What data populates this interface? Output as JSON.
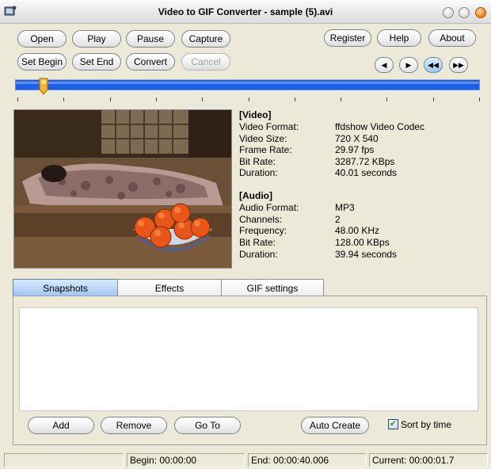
{
  "window": {
    "title": "Video to GIF Converter - sample (5).avi"
  },
  "toolbar": {
    "open": "Open",
    "play": "Play",
    "pause": "Pause",
    "capture": "Capture",
    "set_begin": "Set Begin",
    "set_end": "Set End",
    "convert": "Convert",
    "cancel": "Cancel",
    "register": "Register",
    "help": "Help",
    "about": "About"
  },
  "nav_buttons": {
    "prev": "◀",
    "next": "▶",
    "rewind": "◀◀",
    "forward": "▶▶"
  },
  "position": {
    "fraction": 0.052
  },
  "video_info": {
    "header": "[Video]",
    "rows": [
      {
        "label": "Video Format:",
        "value": "ffdshow Video Codec"
      },
      {
        "label": "Video Size:",
        "value": "720 X 540"
      },
      {
        "label": "Frame Rate:",
        "value": "29.97 fps"
      },
      {
        "label": "Bit Rate:",
        "value": "3287.72 KBps"
      },
      {
        "label": "Duration:",
        "value": "40.01 seconds"
      }
    ]
  },
  "audio_info": {
    "header": "[Audio]",
    "rows": [
      {
        "label": "Audio Format:",
        "value": "MP3"
      },
      {
        "label": "Channels:",
        "value": "2"
      },
      {
        "label": "Frequency:",
        "value": "48.00 KHz"
      },
      {
        "label": "Bit Rate:",
        "value": "128.00 KBps"
      },
      {
        "label": "Duration:",
        "value": "39.94 seconds"
      }
    ]
  },
  "tabs": [
    "Snapshots",
    "Effects",
    "GIF settings"
  ],
  "snapshots": {
    "add": "Add",
    "remove": "Remove",
    "goto": "Go To",
    "auto_create": "Auto Create",
    "sort_label": "Sort by time",
    "sort_checked": true
  },
  "status": {
    "begin": "Begin: 00:00:00",
    "end": "End: 00:00:40.006",
    "current": "Current: 00:00:01.7"
  }
}
